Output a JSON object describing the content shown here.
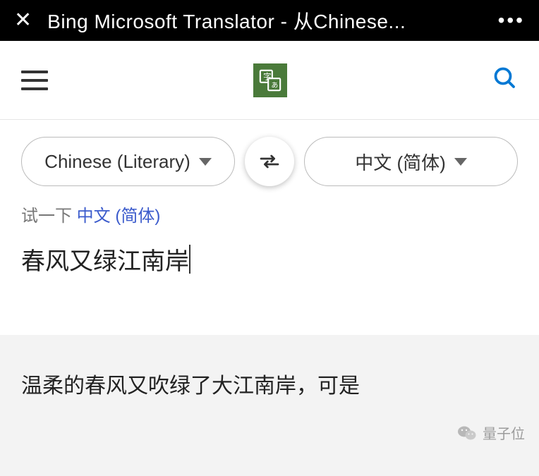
{
  "browser": {
    "title": "Bing Microsoft Translator - 从Chinese..."
  },
  "languages": {
    "source": "Chinese (Literary)",
    "target": "中文 (简体)"
  },
  "try": {
    "prefix": "试一下",
    "link": "中文 (简体)"
  },
  "input": {
    "text": "春风又绿江南岸"
  },
  "output": {
    "text": "温柔的春风又吹绿了大江南岸，可是"
  },
  "watermark": "量子位"
}
